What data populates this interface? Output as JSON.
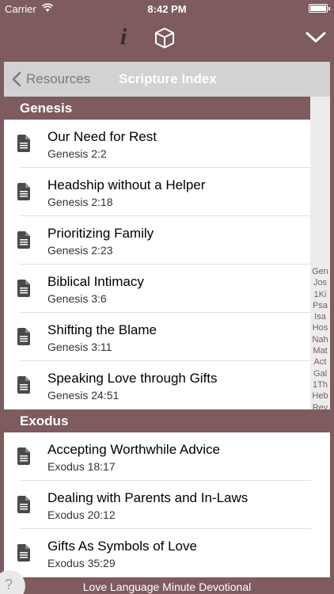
{
  "status": {
    "carrier": "Carrier",
    "time": "8:42 PM"
  },
  "nav": {
    "back_label": "Resources",
    "title": "Scripture Index"
  },
  "sections": [
    {
      "header": "Genesis",
      "items": [
        {
          "title": "Our Need for Rest",
          "ref": "Genesis 2:2"
        },
        {
          "title": "Headship without a Helper",
          "ref": "Genesis 2:18"
        },
        {
          "title": "Prioritizing Family",
          "ref": "Genesis 2:23"
        },
        {
          "title": "Biblical Intimacy",
          "ref": "Genesis 3:6"
        },
        {
          "title": "Shifting the Blame",
          "ref": "Genesis 3:11"
        },
        {
          "title": "Speaking Love through Gifts",
          "ref": "Genesis 24:51"
        }
      ]
    },
    {
      "header": "Exodus",
      "items": [
        {
          "title": "Accepting Worthwhile Advice",
          "ref": "Exodus 18:17"
        },
        {
          "title": "Dealing with Parents and In-Laws",
          "ref": "Exodus 20:12"
        },
        {
          "title": "Gifts As Symbols of Love",
          "ref": "Exodus 35:29"
        }
      ]
    }
  ],
  "index": [
    "Gen",
    "Jos",
    "1Ki",
    "Psa",
    "Isa",
    "Hos",
    "Nah",
    "Mat",
    "Act",
    "Gal",
    "1Th",
    "Heb",
    "Rev"
  ],
  "footer": {
    "text": "Love Language Minute Devotional",
    "help": "?"
  },
  "toolbar": {
    "info": "i"
  },
  "colors": {
    "accent": "#7d5b5e",
    "nav_bg": "#d2d2d2",
    "index_text": "#7d5b5e"
  }
}
